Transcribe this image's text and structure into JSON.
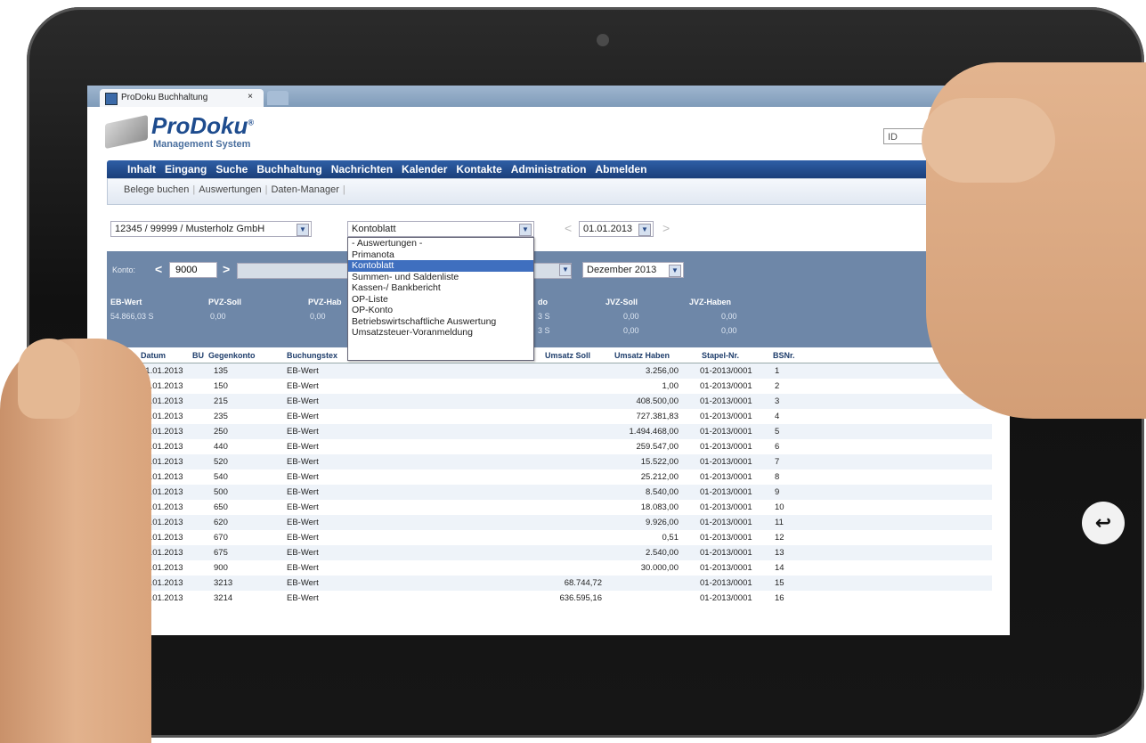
{
  "browser": {
    "tab_title": "ProDoku Buchhaltung",
    "tab_close": "×"
  },
  "logo": {
    "name": "ProDoku",
    "registered": "®",
    "subtitle": "Management System"
  },
  "id_field": {
    "value": "ID"
  },
  "menu": [
    "Inhalt",
    "Eingang",
    "Suche",
    "Buchhaltung",
    "Nachrichten",
    "Kalender",
    "Kontakte",
    "Administration",
    "Abmelden"
  ],
  "submenu": [
    "Belege buchen",
    "Auswertungen",
    "Daten-Manager"
  ],
  "controls": {
    "client_select": "12345 / 99999 / Musterholz GmbH",
    "report_select": "Kontoblatt",
    "date_select": "01.01.2013",
    "month_select": "Dezember 2013",
    "arrow_prev": "<",
    "arrow_next": ">",
    "dropdown_arrow": "▼"
  },
  "dropdown_options": [
    "- Auswertungen -",
    "Primanota",
    "Kontoblatt",
    "Summen- und Saldenliste",
    "Kassen-/ Bankbericht",
    "OP-Liste",
    "OP-Konto",
    "Betriebswirtschaftliche Auswertung",
    "Umsatzsteuer-Voranmeldung"
  ],
  "dropdown_selected_index": 2,
  "konto": {
    "label": "Konto:",
    "value": "9000",
    "headers": {
      "eb_wert": "EB-Wert",
      "pvz_soll": "PVZ-Soll",
      "pvz_haben": "PVZ-Hab",
      "saldo": "do",
      "jvz_soll": "JVZ-Soll",
      "jvz_haben": "JVZ-Haben"
    },
    "values": {
      "eb_wert": "54.866,03 S",
      "pvz_soll": "0,00",
      "pvz_haben": "0,00",
      "saldo1": "3 S",
      "saldo2": "3 S",
      "jvz_soll1": "0,00",
      "jvz_soll2": "0,00",
      "jvz_haben1": "0,00",
      "jvz_haben2": "0,00"
    }
  },
  "table": {
    "headers": {
      "datum": "Datum",
      "bu": "BU",
      "gegenkonto": "Gegenkonto",
      "buchungstext": "Buchungstex",
      "umsatz_soll": "Umsatz Soll",
      "umsatz_haben": "Umsatz Haben",
      "stapel": "Stapel-Nr.",
      "bsnr": "BSNr."
    },
    "rows": [
      {
        "datum": "01.01.2013",
        "gegenkonto": "135",
        "text": "EB-Wert",
        "soll": "",
        "haben": "3.256,00",
        "stapel": "01-2013/0001",
        "bsnr": "1"
      },
      {
        "datum": "01.01.2013",
        "gegenkonto": "150",
        "text": "EB-Wert",
        "soll": "",
        "haben": "1,00",
        "stapel": "01-2013/0001",
        "bsnr": "2"
      },
      {
        "datum": "01.01.2013",
        "gegenkonto": "215",
        "text": "EB-Wert",
        "soll": "",
        "haben": "408.500,00",
        "stapel": "01-2013/0001",
        "bsnr": "3"
      },
      {
        "datum": "01.01.2013",
        "gegenkonto": "235",
        "text": "EB-Wert",
        "soll": "",
        "haben": "727.381,83",
        "stapel": "01-2013/0001",
        "bsnr": "4"
      },
      {
        "datum": "01.01.2013",
        "gegenkonto": "250",
        "text": "EB-Wert",
        "soll": "",
        "haben": "1.494.468,00",
        "stapel": "01-2013/0001",
        "bsnr": "5"
      },
      {
        "datum": "01.01.2013",
        "gegenkonto": "440",
        "text": "EB-Wert",
        "soll": "",
        "haben": "259.547,00",
        "stapel": "01-2013/0001",
        "bsnr": "6"
      },
      {
        "datum": "01.01.2013",
        "gegenkonto": "520",
        "text": "EB-Wert",
        "soll": "",
        "haben": "15.522,00",
        "stapel": "01-2013/0001",
        "bsnr": "7"
      },
      {
        "datum": "01.01.2013",
        "gegenkonto": "540",
        "text": "EB-Wert",
        "soll": "",
        "haben": "25.212,00",
        "stapel": "01-2013/0001",
        "bsnr": "8"
      },
      {
        "datum": "01.01.2013",
        "gegenkonto": "500",
        "text": "EB-Wert",
        "soll": "",
        "haben": "8.540,00",
        "stapel": "01-2013/0001",
        "bsnr": "9"
      },
      {
        "datum": "01.01.2013",
        "gegenkonto": "650",
        "text": "EB-Wert",
        "soll": "",
        "haben": "18.083,00",
        "stapel": "01-2013/0001",
        "bsnr": "10"
      },
      {
        "datum": "01.01.2013",
        "gegenkonto": "620",
        "text": "EB-Wert",
        "soll": "",
        "haben": "9.926,00",
        "stapel": "01-2013/0001",
        "bsnr": "11"
      },
      {
        "datum": "01.01.2013",
        "gegenkonto": "670",
        "text": "EB-Wert",
        "soll": "",
        "haben": "0,51",
        "stapel": "01-2013/0001",
        "bsnr": "12"
      },
      {
        "datum": "01.01.2013",
        "gegenkonto": "675",
        "text": "EB-Wert",
        "soll": "",
        "haben": "2.540,00",
        "stapel": "01-2013/0001",
        "bsnr": "13"
      },
      {
        "datum": "01.01.2013",
        "gegenkonto": "900",
        "text": "EB-Wert",
        "soll": "",
        "haben": "30.000,00",
        "stapel": "01-2013/0001",
        "bsnr": "14"
      },
      {
        "datum": "01.01.2013",
        "gegenkonto": "3213",
        "text": "EB-Wert",
        "soll": "68.744,72",
        "haben": "",
        "stapel": "01-2013/0001",
        "bsnr": "15"
      },
      {
        "datum": "01.01.2013",
        "gegenkonto": "3214",
        "text": "EB-Wert",
        "soll": "636.595,16",
        "haben": "",
        "stapel": "01-2013/0001",
        "bsnr": "16"
      }
    ]
  },
  "device": {
    "home_icon": "home-icon",
    "back_icon": "back-icon",
    "home_glyph": "⌂",
    "back_glyph": "↩"
  },
  "colors": {
    "menubar": "#1b3f7a",
    "panel": "#6e87a8",
    "highlight": "#3f6fbf"
  }
}
